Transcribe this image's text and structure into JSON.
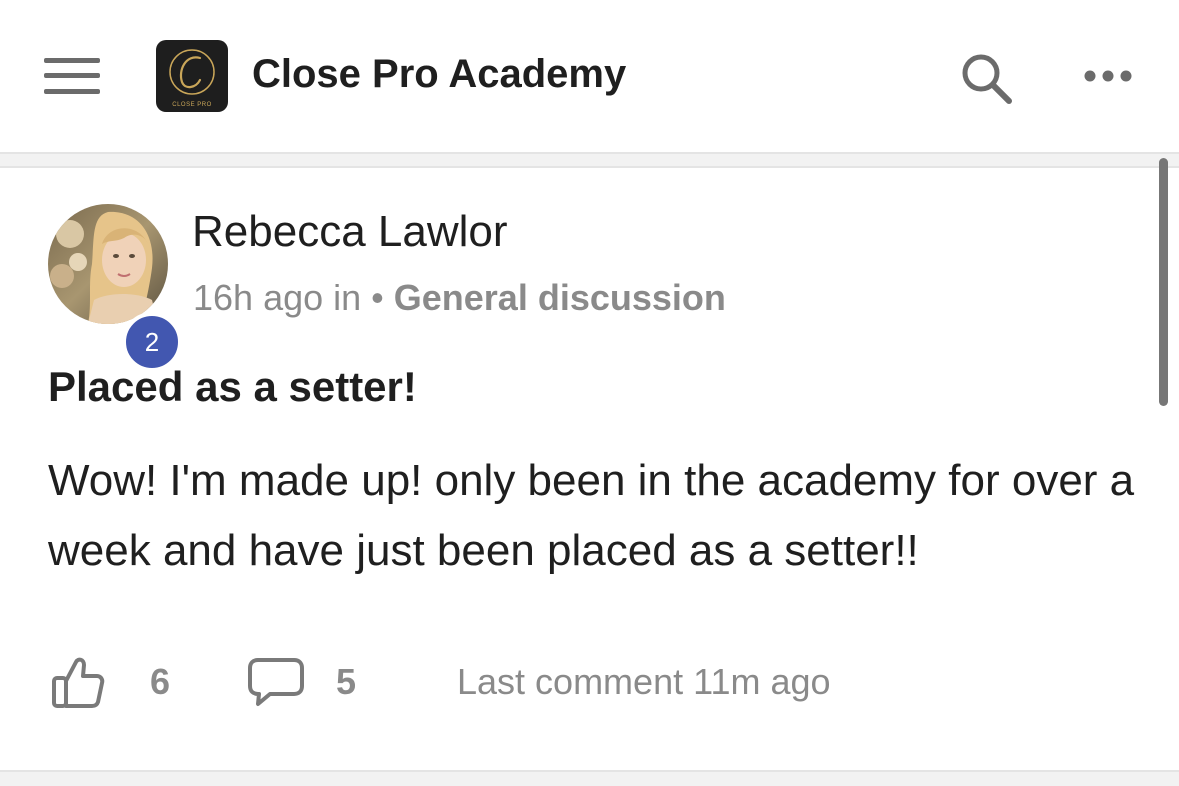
{
  "header": {
    "app_title": "Close Pro Academy",
    "logo_text": "CLOSE PRO",
    "icons": {
      "menu": "hamburger-menu-icon",
      "search": "search-icon",
      "more": "more-horizontal-icon"
    }
  },
  "post": {
    "author_name": "Rebecca Lawlor",
    "author_level": "2",
    "time_ago": "16h ago in",
    "separator": "•",
    "category": "General discussion",
    "title": "Placed as a setter!",
    "body": "Wow! I'm made up! only been in the academy for over a week and have just been placed as a setter!!",
    "like_count": "6",
    "comment_count": "5",
    "last_comment": "Last comment 11m ago",
    "icons": {
      "like": "thumbs-up-icon",
      "comment": "comment-bubble-icon"
    }
  },
  "colors": {
    "level_badge": "#4257b0",
    "muted_text": "#8a8a8a",
    "primary_text": "#1f1f1f",
    "logo_background": "#1e1e1e",
    "logo_gold": "#c9a659"
  }
}
